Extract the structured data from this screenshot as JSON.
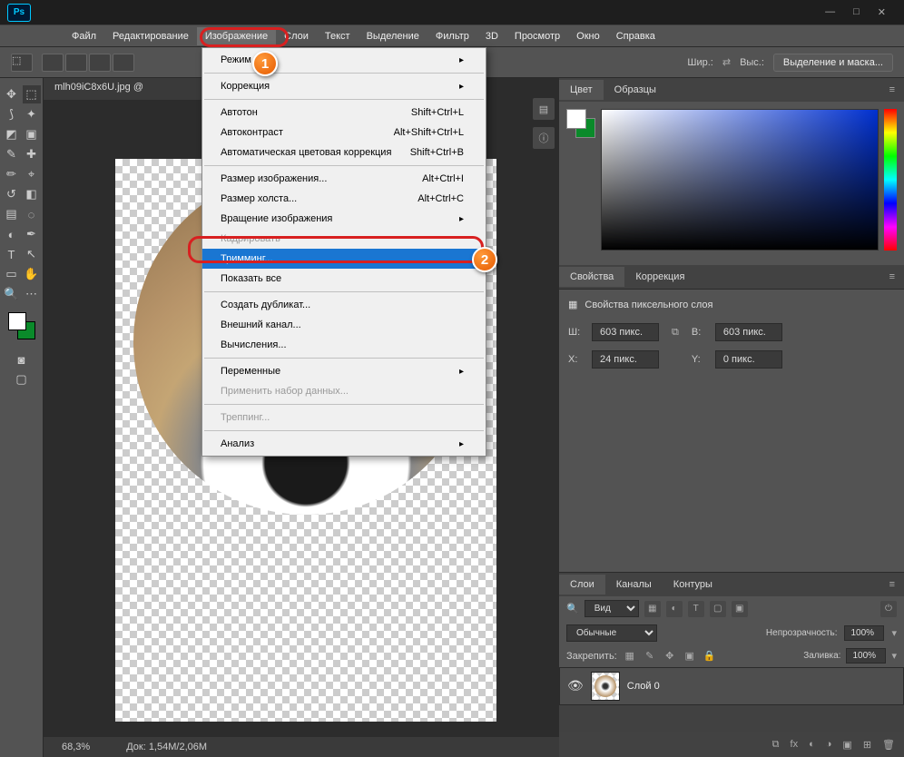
{
  "menubar": [
    "Файл",
    "Редактирование",
    "Изображение",
    "Слои",
    "Текст",
    "Выделение",
    "Фильтр",
    "3D",
    "Просмотр",
    "Окно",
    "Справка"
  ],
  "active_menu_index": 2,
  "options_bar": {
    "width_label": "Шир.:",
    "height_label": "Выс.:",
    "mask_button": "Выделение и маска..."
  },
  "document_tab": "mlh09iC8x6U.jpg @",
  "dropdown": {
    "items": [
      {
        "label": "Режим",
        "type": "submenu"
      },
      {
        "type": "sep"
      },
      {
        "label": "Коррекция",
        "type": "submenu"
      },
      {
        "type": "sep"
      },
      {
        "label": "Автотон",
        "shortcut": "Shift+Ctrl+L"
      },
      {
        "label": "Автоконтраст",
        "shortcut": "Alt+Shift+Ctrl+L"
      },
      {
        "label": "Автоматическая цветовая коррекция",
        "shortcut": "Shift+Ctrl+B"
      },
      {
        "type": "sep"
      },
      {
        "label": "Размер изображения...",
        "shortcut": "Alt+Ctrl+I"
      },
      {
        "label": "Размер холста...",
        "shortcut": "Alt+Ctrl+C"
      },
      {
        "label": "Вращение изображения",
        "type": "submenu"
      },
      {
        "label": "Кадрировать",
        "disabled": true
      },
      {
        "label": "Тримминг...",
        "highlighted": true
      },
      {
        "label": "Показать все"
      },
      {
        "type": "sep"
      },
      {
        "label": "Создать дубликат..."
      },
      {
        "label": "Внешний канал..."
      },
      {
        "label": "Вычисления..."
      },
      {
        "type": "sep"
      },
      {
        "label": "Переменные",
        "type": "submenu"
      },
      {
        "label": "Применить набор данных...",
        "disabled": true
      },
      {
        "type": "sep"
      },
      {
        "label": "Треппинг...",
        "disabled": true
      },
      {
        "type": "sep"
      },
      {
        "label": "Анализ",
        "type": "submenu"
      }
    ]
  },
  "panels": {
    "color_tabs": [
      "Цвет",
      "Образцы"
    ],
    "props_tabs": [
      "Свойства",
      "Коррекция"
    ],
    "props_title": "Свойства пиксельного слоя",
    "props": {
      "w_label": "Ш:",
      "w": "603 пикс.",
      "h_label": "В:",
      "h": "603 пикс.",
      "x_label": "X:",
      "x": "24 пикс.",
      "y_label": "Y:",
      "y": "0 пикс."
    },
    "layers_tabs": [
      "Слои",
      "Каналы",
      "Контуры"
    ],
    "layers": {
      "filter_kind": "Вид",
      "blend": "Обычные",
      "opacity_label": "Непрозрачность:",
      "opacity": "100%",
      "lock_label": "Закрепить:",
      "fill_label": "Заливка:",
      "fill": "100%",
      "layer0": "Слой 0"
    }
  },
  "status": {
    "zoom": "68,3%",
    "doc": "Док: 1,54M/2,06M"
  },
  "badges": {
    "one": "1",
    "two": "2"
  }
}
